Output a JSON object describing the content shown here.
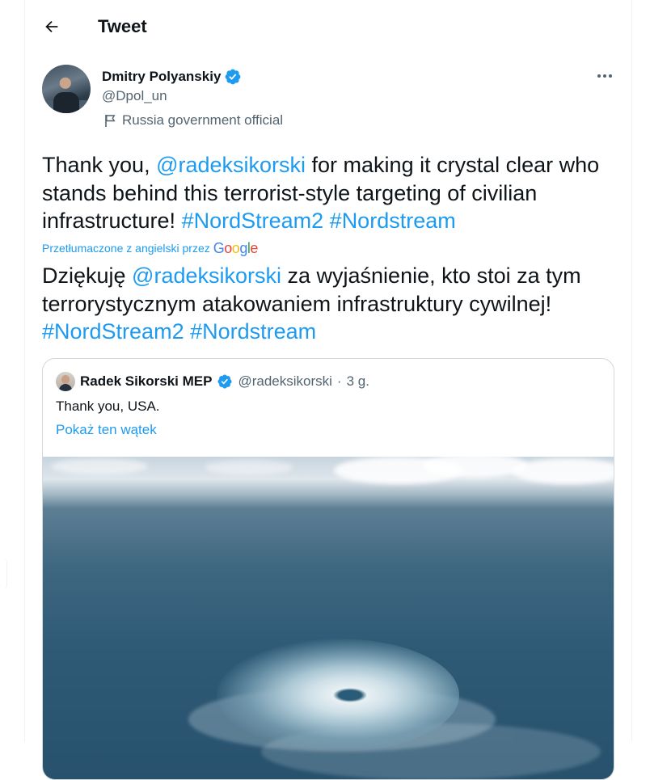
{
  "header": {
    "title": "Tweet",
    "back_icon": "arrow-left-icon"
  },
  "author": {
    "name": "Dmitry Polyanskiy",
    "handle": "@Dpol_un",
    "label": "Russia government official",
    "verified": true
  },
  "tweet": {
    "text_parts": [
      "Thank you, ",
      "@radeksikorski",
      " for making it crystal clear who stands behind this terrorist-style targeting of civilian infrastructure! ",
      "#NordStream2",
      " ",
      "#Nordstream"
    ],
    "translated_by": "Przetłumaczone z angielski przez",
    "translator": "Google",
    "translated_parts": [
      "Dziękuję ",
      "@radeksikorski",
      " za wyjaśnienie, kto stoi za tym terrorystycznym atakowaniem infrastruktury cywilnej! ",
      "#NordStream2",
      " ",
      "#Nordstream"
    ]
  },
  "quote": {
    "name": "Radek Sikorski MEP",
    "handle": "@radeksikorski",
    "separator": "·",
    "time": "3 g.",
    "text": "Thank you, USA.",
    "show_thread": "Pokaż ten wątek"
  },
  "colors": {
    "accent": "#1d9bf0",
    "text": "#0f1419",
    "secondary": "#536471",
    "border": "#cfd9de"
  }
}
